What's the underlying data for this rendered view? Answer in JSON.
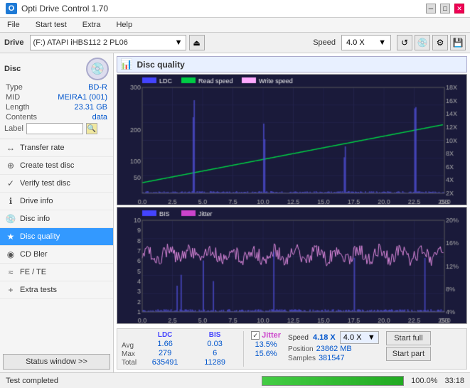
{
  "titlebar": {
    "title": "Opti Drive Control 1.70",
    "icon_text": "O"
  },
  "menubar": {
    "items": [
      "File",
      "Start test",
      "Extra",
      "Help"
    ]
  },
  "toolbar": {
    "drive_label": "Drive",
    "drive_value": "(F:) ATAPI iHBS112  2 PL06",
    "speed_label": "Speed",
    "speed_value": "4.0 X"
  },
  "disc_panel": {
    "type_label": "Type",
    "type_value": "BD-R",
    "mid_label": "MID",
    "mid_value": "MEIRA1 (001)",
    "length_label": "Length",
    "length_value": "23.31 GB",
    "contents_label": "Contents",
    "contents_value": "data",
    "label_label": "Label",
    "label_value": ""
  },
  "nav_items": [
    {
      "id": "transfer-rate",
      "label": "Transfer rate",
      "icon": "↔"
    },
    {
      "id": "create-test-disc",
      "label": "Create test disc",
      "icon": "⊕"
    },
    {
      "id": "verify-test-disc",
      "label": "Verify test disc",
      "icon": "✓"
    },
    {
      "id": "drive-info",
      "label": "Drive info",
      "icon": "ℹ"
    },
    {
      "id": "disc-info",
      "label": "Disc info",
      "icon": "💿"
    },
    {
      "id": "disc-quality",
      "label": "Disc quality",
      "icon": "★",
      "active": true
    },
    {
      "id": "cd-bler",
      "label": "CD Bler",
      "icon": "◉"
    },
    {
      "id": "fe-te",
      "label": "FE / TE",
      "icon": "≈"
    },
    {
      "id": "extra-tests",
      "label": "Extra tests",
      "icon": "+"
    }
  ],
  "chart": {
    "title": "Disc quality",
    "legend_top": [
      "LDC",
      "Read speed",
      "Write speed"
    ],
    "legend_bottom": [
      "BIS",
      "Jitter"
    ],
    "x_labels": [
      "0.0",
      "2.5",
      "5.0",
      "7.5",
      "10.0",
      "12.5",
      "15.0",
      "17.5",
      "20.0",
      "22.5",
      "25.0"
    ],
    "y_left_top": [
      "300",
      "200",
      "100",
      "50"
    ],
    "y_right_top": [
      "18X",
      "16X",
      "14X",
      "12X",
      "10X",
      "8X",
      "6X",
      "4X",
      "2X"
    ],
    "y_left_bottom": [
      "10",
      "9",
      "8",
      "7",
      "6",
      "5",
      "4",
      "3",
      "2",
      "1"
    ],
    "y_right_bottom": [
      "20%",
      "16%",
      "12%",
      "8%",
      "4%"
    ]
  },
  "stats": {
    "ldc_label": "LDC",
    "bis_label": "BIS",
    "jitter_label": "Jitter",
    "speed_label": "Speed",
    "avg_label": "Avg",
    "max_label": "Max",
    "total_label": "Total",
    "ldc_avg": "1.66",
    "ldc_max": "279",
    "ldc_total": "635491",
    "bis_avg": "0.03",
    "bis_max": "6",
    "bis_total": "11289",
    "jitter_avg": "13.5%",
    "jitter_max": "15.6%",
    "jitter_total": "",
    "speed_avg": "4.18 X",
    "speed_label2": "4.0 X",
    "position_label": "Position",
    "position_value": "23862 MB",
    "samples_label": "Samples",
    "samples_value": "381547",
    "start_full": "Start full",
    "start_part": "Start part"
  },
  "status_bar": {
    "text": "Test completed",
    "progress": 100,
    "time": "33:18"
  },
  "colors": {
    "accent": "#3399ff",
    "ldc_color": "#4444ff",
    "read_speed_color": "#00cc44",
    "write_speed_color": "#ffaaff",
    "bis_color": "#4444ff",
    "jitter_color": "#cc44cc",
    "grid_color": "#2a2a5a",
    "bg_chart": "#1a1a3a"
  }
}
